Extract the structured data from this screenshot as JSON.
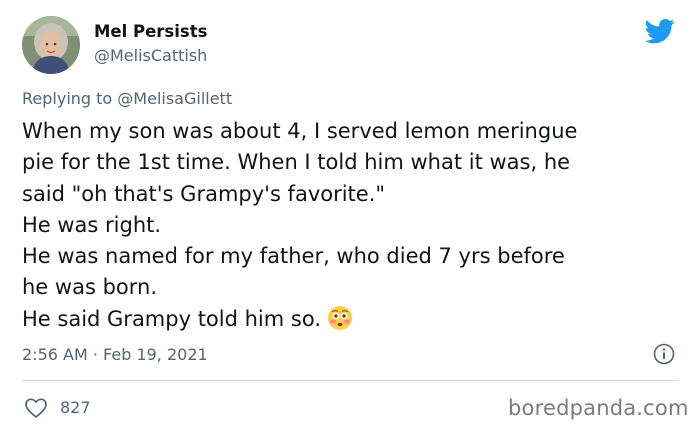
{
  "author": {
    "name": "Mel Persists",
    "handle": "@MelisCattish"
  },
  "reply_to": "Replying to @MelisaGillett",
  "body": {
    "line1": "When my son was about 4, I served lemon meringue",
    "line2": "pie for the 1st time. When I told him what it was, he",
    "line3": "said \"oh that's Grampy's favorite.\"",
    "line4": "He was right.",
    "line5": "He was named for my father, who died 7 yrs before",
    "line6": "he was born.",
    "line7": "He said Grampy told him so."
  },
  "timestamp": "2:56 AM · Feb 19, 2021",
  "likes_count": "827",
  "watermark": "boredpanda.com",
  "colors": {
    "twitter_blue": "#1d9bf0",
    "secondary_text": "#536471",
    "primary_text": "#0f1419",
    "divider": "#cfd9de"
  },
  "icons": {
    "brand": "twitter-bird-icon",
    "info": "info-icon",
    "like": "heart-icon",
    "emoji": "flushed-face-emoji"
  }
}
